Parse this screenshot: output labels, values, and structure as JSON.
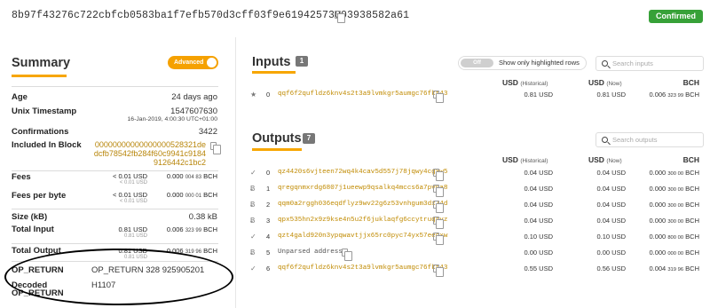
{
  "header": {
    "tx_hash": "8b97f43276c722cbfcb0583ba1f7efb570d3cff03f9e61942573003938582a61",
    "status": "Confirmed"
  },
  "summary": {
    "title": "Summary",
    "advanced_toggle": "Advanced",
    "age_label": "Age",
    "age_value": "24 days ago",
    "unix_label": "Unix Timestamp",
    "unix_value": "1547607630",
    "unix_date": "16-Jan-2019, 4:00:30 UTC+01:00",
    "confirmations_label": "Confirmations",
    "confirmations_value": "3422",
    "block_label": "Included In Block",
    "block_line1": "00000000000000000528321de",
    "block_line2": "dcfb78542fb284f60c9941c9184",
    "block_line3": "9126442c1bc2",
    "fees_label": "Fees",
    "fees_usd": "< 0.01 USD",
    "fees_usd_hist": "< 0.01 USD",
    "fees_bch_main": "0.000",
    "fees_bch_small": "004 83",
    "fees_bch_unit": "BCH",
    "feebyte_label": "Fees per byte",
    "feebyte_usd": "< 0.01 USD",
    "feebyte_usd_hist": "< 0.01 USD",
    "feebyte_bch_main": "0.000",
    "feebyte_bch_small": "000 01",
    "feebyte_bch_unit": "BCH",
    "size_label": "Size (kB)",
    "size_value": "0.38 kB",
    "total_input_label": "Total Input",
    "total_input_usd": "0.81 USD",
    "total_input_usd_hist": "0.81 USD",
    "total_input_bch_main": "0.006",
    "total_input_bch_small": "323 99",
    "total_input_bch_unit": "BCH",
    "total_output_label": "Total Output",
    "total_output_usd": "0.81 USD",
    "total_output_usd_hist": "0.81 USD",
    "total_output_bch_main": "0.006",
    "total_output_bch_small": "319 96",
    "total_output_bch_unit": "BCH",
    "op_return_label": "OP_RETURN",
    "op_return_value": "OP_RETURN 328 925905201",
    "decoded_label_1": "Decoded",
    "decoded_label_2": "OP_RETURN",
    "decoded_value": "H1107"
  },
  "inputs": {
    "title": "Inputs",
    "count": "1",
    "toggle_off": "Off",
    "toggle_label": "Show only highlighted rows",
    "search_placeholder": "Search inputs",
    "col_usd": "USD",
    "col_usd_sub": "(Historical)",
    "col_usd_now": "USD",
    "col_usd_now_sub": "(Now)",
    "col_bch": "BCH",
    "rows": [
      {
        "icon": "★",
        "idx": "0",
        "addr": "qqf6f2qufldz6knv4s2t3a9lvmkgr5aumgc76fkt43",
        "usd_hist": "0.81 USD",
        "usd_now": "0.81 USD",
        "bch_main": "0.006",
        "bch_small": "323 99",
        "bch_unit": "BCH"
      }
    ]
  },
  "outputs": {
    "title": "Outputs",
    "count": "7",
    "search_placeholder": "Search outputs",
    "col_usd": "USD",
    "col_usd_sub": "(Historical)",
    "col_usd_now": "USD",
    "col_usd_now_sub": "(Now)",
    "col_bch": "BCH",
    "rows": [
      {
        "icon": "✓",
        "idx": "0",
        "addr": "qz4420s6vjteen72wq4k4cav5d557j78jqwy4cgxw5",
        "usd_hist": "0.04 USD",
        "usd_now": "0.04 USD",
        "bch_main": "0.000",
        "bch_small": "300 00",
        "bch_unit": "BCH"
      },
      {
        "icon": "Ƀ",
        "idx": "1",
        "addr": "qregqnmxrdg6807j1ueewp9qsalkq4mccs6a7pv6a8",
        "usd_hist": "0.04 USD",
        "usd_now": "0.04 USD",
        "bch_main": "0.000",
        "bch_small": "300 00",
        "bch_unit": "BCH"
      },
      {
        "icon": "Ƀ",
        "idx": "2",
        "addr": "qqm0a2rggh036eqdflyz9wv22g6z53vnhgum3dx74d",
        "usd_hist": "0.04 USD",
        "usd_now": "0.04 USD",
        "bch_main": "0.000",
        "bch_small": "300 00",
        "bch_unit": "BCH"
      },
      {
        "icon": "Ƀ",
        "idx": "3",
        "addr": "qpx535hn2x9z9kse4n5u2f6juklaqfg6ccytruqrvz",
        "usd_hist": "0.04 USD",
        "usd_now": "0.04 USD",
        "bch_main": "0.000",
        "bch_small": "300 00",
        "bch_unit": "BCH"
      },
      {
        "icon": "✓",
        "idx": "4",
        "addr": "qzt4gald920n3ypqwavtjjx65rc0pyc74yx57eecxw",
        "usd_hist": "0.10 USD",
        "usd_now": "0.10 USD",
        "bch_main": "0.000",
        "bch_small": "800 00",
        "bch_unit": "BCH"
      },
      {
        "icon": "Ƀ",
        "idx": "5",
        "addr": "Unparsed address",
        "usd_hist": "0.00 USD",
        "usd_now": "0.00 USD",
        "bch_main": "0.000",
        "bch_small": "000 00",
        "bch_unit": "BCH"
      },
      {
        "icon": "✓",
        "idx": "6",
        "addr": "qqf6f2qufldz6knv4s2t3a9lvmkgr5aumgc76fkt43",
        "usd_hist": "0.55 USD",
        "usd_now": "0.56 USD",
        "bch_main": "0.004",
        "bch_small": "319 96",
        "bch_unit": "BCH"
      }
    ]
  }
}
